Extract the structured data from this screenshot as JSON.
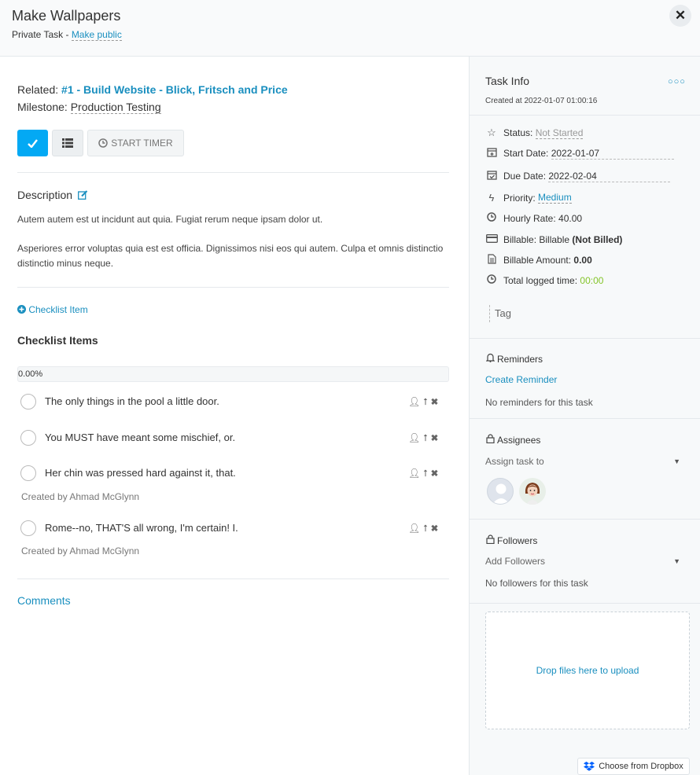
{
  "header": {
    "title": "Make Wallpapers",
    "privacy": "Private Task -",
    "make_public": "Make public",
    "close_glyph": "✕"
  },
  "task": {
    "related_label": "Related:",
    "related_link": "#1 - Build Website - Blick, Fritsch and Price",
    "milestone_label": "Milestone:",
    "milestone_value": "Production Testing",
    "timer_label": "START TIMER"
  },
  "description": {
    "heading": "Description",
    "paragraphs": [
      "Autem autem est ut incidunt aut quia. Fugiat rerum neque ipsam dolor ut.",
      "Asperiores error voluptas quia est est officia. Dignissimos nisi eos qui autem. Culpa et omnis distinctio distinctio minus neque."
    ]
  },
  "checklist": {
    "add_label": "Checklist Item",
    "heading": "Checklist Items",
    "progress_text": "0.00%",
    "progress_value": 0,
    "items": [
      {
        "text": "The only things in the pool a little door.",
        "created_by": ""
      },
      {
        "text": "You MUST have meant some mischief, or.",
        "created_by": ""
      },
      {
        "text": "Her chin was pressed hard against it, that.",
        "created_by": "Created by Ahmad McGlynn"
      },
      {
        "text": "Rome--no, THAT'S all wrong, I'm certain! I.",
        "created_by": "Created by Ahmad McGlynn"
      }
    ]
  },
  "comments_label": "Comments",
  "side": {
    "title": "Task Info",
    "created_at": "Created at 2022-01-07 01:00:16",
    "status_label": "Status:",
    "status_value": "Not Started",
    "start_label": "Start Date:",
    "start_value": "2022-01-07",
    "due_label": "Due Date:",
    "due_value": "2022-02-04",
    "priority_label": "Priority:",
    "priority_value": "Medium",
    "hourly_label": "Hourly Rate:",
    "hourly_value": "40.00",
    "billable_label": "Billable:",
    "billable_value": "Billable",
    "billable_status": "(Not Billed)",
    "amount_label": "Billable Amount:",
    "amount_value": "0.00",
    "logged_label": "Total logged time:",
    "logged_value": "00:00",
    "tag_placeholder": "Tag",
    "reminders_heading": "Reminders",
    "create_reminder": "Create Reminder",
    "no_reminders": "No reminders for this task",
    "assignees_heading": "Assignees",
    "assign_placeholder": "Assign task to",
    "followers_heading": "Followers",
    "followers_placeholder": "Add Followers",
    "no_followers": "No followers for this task",
    "drop_text": "Drop files here to upload",
    "dropbox_label": "Choose from Dropbox"
  },
  "colors": {
    "accent": "#1a8fbf",
    "primary_button": "#03a9f4",
    "logged_time": "#84c529",
    "status": "#999999"
  }
}
